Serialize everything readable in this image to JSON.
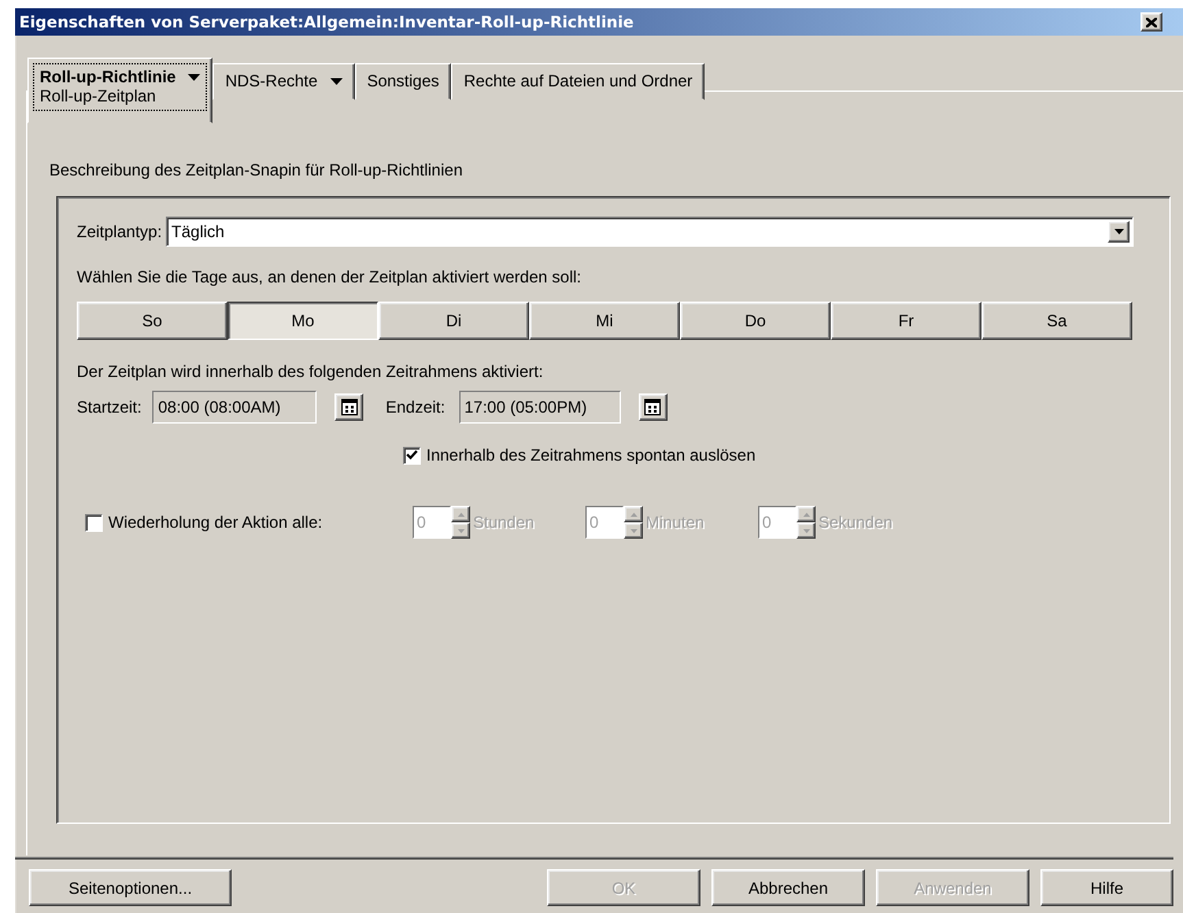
{
  "window": {
    "title": "Eigenschaften von Serverpaket:Allgemein:Inventar-Roll-up-Richtlinie"
  },
  "tabs": [
    {
      "label": "Roll-up-Richtlinie",
      "has_menu": true,
      "selected": true,
      "subpage": "Roll-up-Zeitplan"
    },
    {
      "label": "NDS-Rechte",
      "has_menu": true,
      "selected": false
    },
    {
      "label": "Sonstiges",
      "has_menu": false,
      "selected": false
    },
    {
      "label": "Rechte auf Dateien und Ordner",
      "has_menu": false,
      "selected": false
    }
  ],
  "description": "Beschreibung des Zeitplan-Snapin für Roll-up-Richtlinien",
  "schedule_type": {
    "label": "Zeitplantyp:",
    "value": "Täglich"
  },
  "days_prompt": "Wählen Sie die Tage aus, an denen der Zeitplan aktiviert werden soll:",
  "days": [
    {
      "label": "So",
      "selected": false
    },
    {
      "label": "Mo",
      "selected": true
    },
    {
      "label": "Di",
      "selected": false
    },
    {
      "label": "Mi",
      "selected": false
    },
    {
      "label": "Do",
      "selected": false
    },
    {
      "label": "Fr",
      "selected": false
    },
    {
      "label": "Sa",
      "selected": false
    }
  ],
  "timeframe_prompt": "Der Zeitplan wird innerhalb des folgenden Zeitrahmens aktiviert:",
  "start": {
    "label": "Startzeit:",
    "value": "08:00 (08:00AM)"
  },
  "end": {
    "label": "Endzeit:",
    "value": "17:00 (05:00PM)"
  },
  "spontaneous": {
    "label": "Innerhalb des Zeitrahmens spontan auslösen",
    "checked": true
  },
  "repeat": {
    "label": "Wiederholung der Aktion alle:",
    "checked": false,
    "units": [
      {
        "value": "0",
        "label": "Stunden",
        "disabled": true
      },
      {
        "value": "0",
        "label": "Minuten",
        "disabled": true
      },
      {
        "value": "0",
        "label": "Sekunden",
        "disabled": true
      }
    ]
  },
  "buttons": [
    {
      "label": "Seitenoptionen...",
      "disabled": false
    },
    {
      "label": "OK",
      "disabled": true
    },
    {
      "label": "Abbrechen",
      "disabled": false
    },
    {
      "label": "Anwenden",
      "disabled": true
    },
    {
      "label": "Hilfe",
      "disabled": false
    }
  ]
}
